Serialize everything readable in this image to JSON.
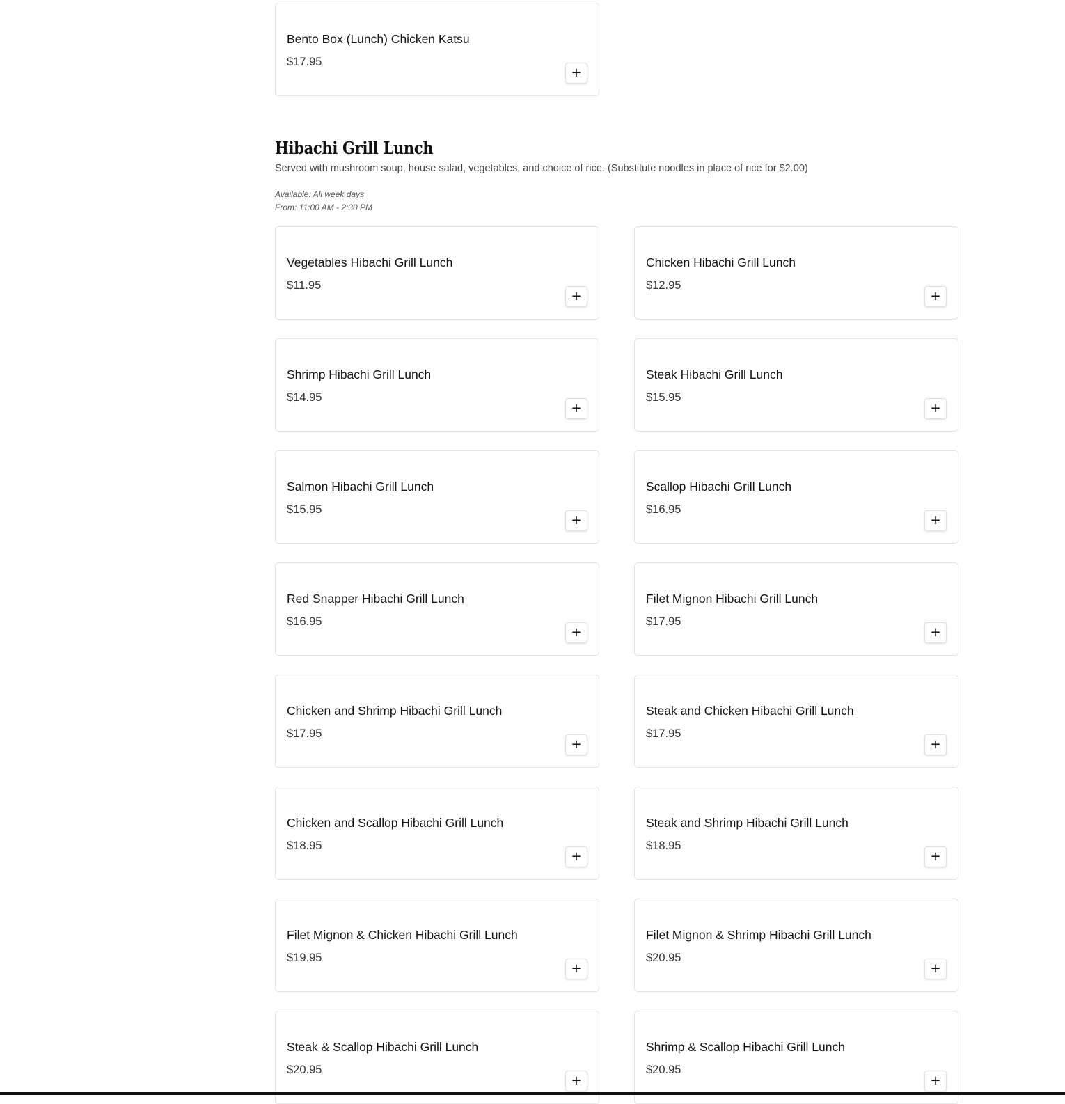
{
  "previous_section": {
    "items": [
      {
        "name": "Bento Box (Lunch) Chicken Katsu",
        "price": "$17.95"
      }
    ]
  },
  "section": {
    "title": "Hibachi Grill Lunch",
    "description": "Served with mushroom soup, house salad, vegetables, and choice of rice. (Substitute noodles in place of rice for $2.00)",
    "available": "Available: All week days",
    "hours": "From: 11:00 AM - 2:30 PM",
    "items": [
      {
        "name": "Vegetables Hibachi Grill Lunch",
        "price": "$11.95"
      },
      {
        "name": "Chicken Hibachi Grill Lunch",
        "price": "$12.95"
      },
      {
        "name": "Shrimp Hibachi Grill Lunch",
        "price": "$14.95"
      },
      {
        "name": "Steak Hibachi Grill Lunch",
        "price": "$15.95"
      },
      {
        "name": "Salmon Hibachi Grill Lunch",
        "price": "$15.95"
      },
      {
        "name": "Scallop Hibachi Grill Lunch",
        "price": "$16.95"
      },
      {
        "name": "Red Snapper Hibachi Grill Lunch",
        "price": "$16.95"
      },
      {
        "name": "Filet Mignon Hibachi Grill Lunch",
        "price": "$17.95"
      },
      {
        "name": "Chicken and Shrimp Hibachi Grill Lunch",
        "price": "$17.95"
      },
      {
        "name": "Steak and Chicken Hibachi Grill Lunch",
        "price": "$17.95"
      },
      {
        "name": "Chicken and Scallop Hibachi Grill Lunch",
        "price": "$18.95"
      },
      {
        "name": "Steak and Shrimp Hibachi Grill Lunch",
        "price": "$18.95"
      },
      {
        "name": "Filet Mignon & Chicken Hibachi Grill Lunch",
        "price": "$19.95"
      },
      {
        "name": "Filet Mignon & Shrimp Hibachi Grill Lunch",
        "price": "$20.95"
      },
      {
        "name": "Steak & Scallop Hibachi Grill Lunch",
        "price": "$20.95"
      },
      {
        "name": "Shrimp & Scallop Hibachi Grill Lunch",
        "price": "$20.95"
      }
    ]
  },
  "add_button_label": "+"
}
